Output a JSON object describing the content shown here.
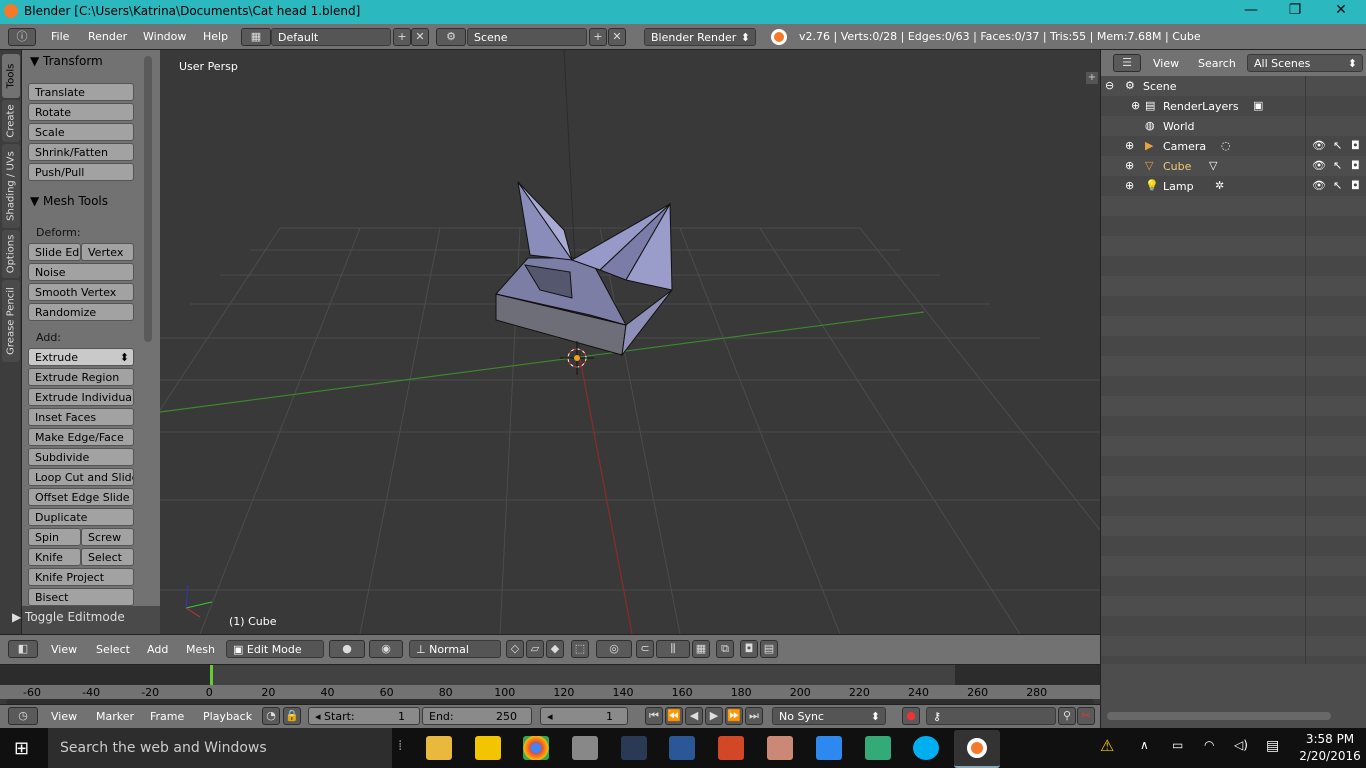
{
  "window": {
    "title": "Blender [C:\\Users\\Katrina\\Documents\\Cat head 1.blend]",
    "minimize": "—",
    "restore": "❐",
    "close": "✕"
  },
  "menubar": {
    "items": [
      "File",
      "Render",
      "Window",
      "Help"
    ],
    "layout": "Default",
    "scene": "Scene",
    "engine": "Blender Render",
    "stats": "v2.76 | Verts:0/28 | Edges:0/63 | Faces:0/37 | Tris:55 | Mem:7.68M | Cube"
  },
  "tool_tabs": [
    "Tools",
    "Create",
    "Shading / UVs",
    "Options",
    "Grease Pencil"
  ],
  "transform": {
    "header": "Transform",
    "buttons": [
      "Translate",
      "Rotate",
      "Scale",
      "Shrink/Fatten",
      "Push/Pull"
    ]
  },
  "mesh_tools": {
    "header": "Mesh Tools",
    "deform_label": "Deform:",
    "slide_edge": "Slide Ed",
    "vertex": "Vertex",
    "noise": "Noise",
    "smooth_vertex": "Smooth Vertex",
    "randomize": "Randomize",
    "add_label": "Add:",
    "extrude": "Extrude",
    "add_buttons": [
      "Extrude Region",
      "Extrude Individual",
      "Inset Faces",
      "Make Edge/Face",
      "Subdivide",
      "Loop Cut and Slide",
      "Offset Edge Slide",
      "Duplicate"
    ],
    "spin": "Spin",
    "screw": "Screw",
    "knife": "Knife",
    "select": "Select",
    "knife_project": "Knife Project",
    "bisect": "Bisect"
  },
  "toggle_editmode": "Toggle Editmode",
  "viewport": {
    "view_name": "User Persp",
    "object_info": "(1) Cube"
  },
  "view3d_header": {
    "menus": [
      "View",
      "Select",
      "Add",
      "Mesh"
    ],
    "mode": "Edit Mode",
    "orientation": "Normal"
  },
  "outliner": {
    "menus": [
      "View",
      "Search"
    ],
    "filter": "All Scenes",
    "items": [
      "Scene",
      "RenderLayers",
      "World",
      "Camera",
      "Cube",
      "Lamp"
    ]
  },
  "timeline": {
    "ticks": [
      "-60",
      "-40",
      "-20",
      "0",
      "20",
      "40",
      "60",
      "80",
      "100",
      "120",
      "140",
      "160",
      "180",
      "200",
      "220",
      "240",
      "260",
      "280"
    ],
    "menus": [
      "View",
      "Marker",
      "Frame",
      "Playback"
    ],
    "start_label": "Start:",
    "start": "1",
    "end_label": "End:",
    "end": "250",
    "current": "1",
    "sync": "No Sync"
  },
  "taskbar": {
    "search_placeholder": "Search the web and Windows",
    "time": "3:58 PM",
    "date": "2/20/2016"
  }
}
